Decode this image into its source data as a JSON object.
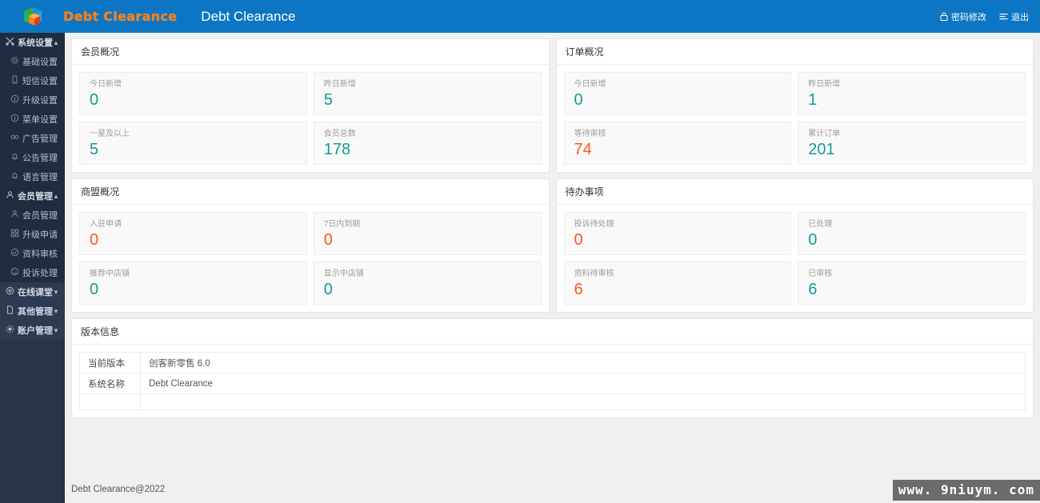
{
  "header": {
    "brand_wordmark": "Debt Clearance",
    "system_title": "Debt Clearance",
    "logo_icon": "cube-logo-icon",
    "actions": [
      {
        "label": "密码修改",
        "icon": "lock-icon"
      },
      {
        "label": "退出",
        "icon": "exit-icon"
      }
    ]
  },
  "sidebar": {
    "groups": [
      {
        "label": "系统设置",
        "icon": "scissors-icon",
        "expanded": true,
        "caret": "▲",
        "items": [
          {
            "label": "基础设置",
            "icon": "gear-icon"
          },
          {
            "label": "短信设置",
            "icon": "mobile-icon"
          },
          {
            "label": "升级设置",
            "icon": "info-circle-icon"
          },
          {
            "label": "菜单设置",
            "icon": "info-circle-icon"
          },
          {
            "label": "广告管理",
            "icon": "infinity-icon"
          },
          {
            "label": "公告管理",
            "icon": "bell-icon"
          },
          {
            "label": "语言管理",
            "icon": "bell-icon"
          }
        ]
      },
      {
        "label": "会员管理",
        "icon": "user-icon",
        "expanded": true,
        "caret": "▲",
        "items": [
          {
            "label": "会员管理",
            "icon": "person-icon"
          },
          {
            "label": "升级申请",
            "icon": "grid-icon"
          },
          {
            "label": "资料审核",
            "icon": "check-circle-icon"
          },
          {
            "label": "投诉处理",
            "icon": "smiley-icon"
          }
        ]
      },
      {
        "label": "在线课堂",
        "icon": "target-icon",
        "expanded": false,
        "caret": "▼",
        "items": []
      },
      {
        "label": "其他管理",
        "icon": "file-icon",
        "expanded": false,
        "caret": "▼",
        "items": []
      },
      {
        "label": "账户管理",
        "icon": "gear-alt-icon",
        "expanded": false,
        "caret": "▼",
        "items": []
      }
    ]
  },
  "panels": {
    "members": {
      "title": "会员概况",
      "tiles": [
        {
          "label": "今日新增",
          "value": "0",
          "color": "teal"
        },
        {
          "label": "昨日新增",
          "value": "5",
          "color": "teal"
        },
        {
          "label": "一星及以上",
          "value": "5",
          "color": "teal"
        },
        {
          "label": "会员总数",
          "value": "178",
          "color": "teal"
        }
      ]
    },
    "orders": {
      "title": "订单概况",
      "tiles": [
        {
          "label": "今日新增",
          "value": "0",
          "color": "teal"
        },
        {
          "label": "昨日新增",
          "value": "1",
          "color": "teal"
        },
        {
          "label": "等待审核",
          "value": "74",
          "color": "orange"
        },
        {
          "label": "累计订单",
          "value": "201",
          "color": "teal"
        }
      ]
    },
    "merchants": {
      "title": "商盟概况",
      "tiles": [
        {
          "label": "入驻申请",
          "value": "0",
          "color": "orange"
        },
        {
          "label": "7日内到期",
          "value": "0",
          "color": "orange"
        },
        {
          "label": "推荐中店铺",
          "value": "0",
          "color": "teal"
        },
        {
          "label": "显示中店铺",
          "value": "0",
          "color": "teal"
        }
      ]
    },
    "todo": {
      "title": "待办事项",
      "tiles": [
        {
          "label": "投诉待处理",
          "value": "0",
          "color": "orange"
        },
        {
          "label": "已处理",
          "value": "0",
          "color": "teal"
        },
        {
          "label": "资料待审核",
          "value": "6",
          "color": "orange"
        },
        {
          "label": "已审核",
          "value": "6",
          "color": "teal"
        }
      ]
    },
    "version": {
      "title": "版本信息",
      "rows": [
        {
          "key": "当前版本",
          "value": "创客新零售 6.0"
        },
        {
          "key": "系统名称",
          "value": "Debt Clearance"
        },
        {
          "key": "",
          "value": ""
        }
      ]
    }
  },
  "footer": {
    "copyright": "Debt Clearance@2022",
    "watermark": "www. 9niuym. com"
  },
  "colors": {
    "header_blue": "#0d76c4",
    "sidebar_dark": "#27344a",
    "accent_teal": "#119d91",
    "accent_orange": "#ff551b",
    "brand_orange": "#f5821f"
  }
}
